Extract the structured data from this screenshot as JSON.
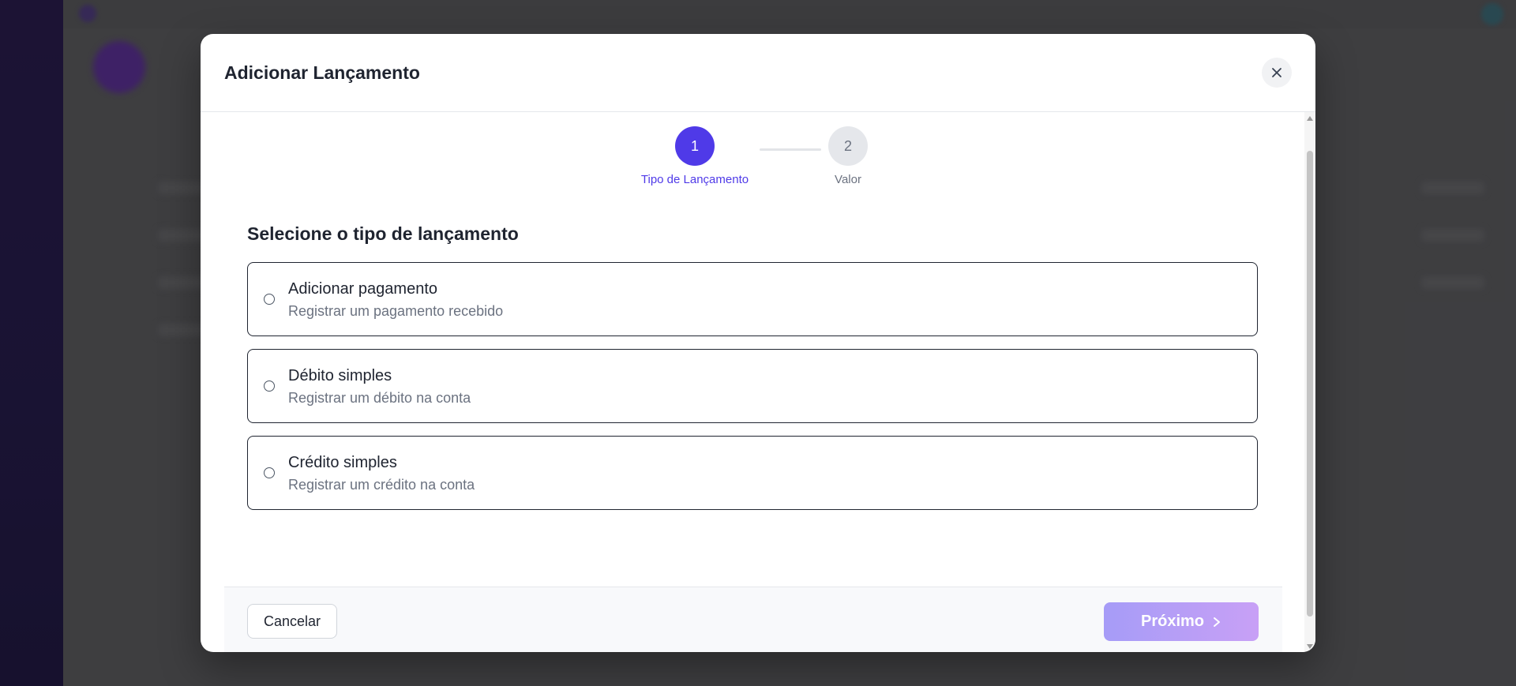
{
  "modal": {
    "title": "Adicionar Lançamento",
    "close_icon": "close-icon"
  },
  "stepper": {
    "steps": [
      {
        "number": "1",
        "label": "Tipo de Lançamento",
        "state": "active"
      },
      {
        "number": "2",
        "label": "Valor",
        "state": "inactive"
      }
    ]
  },
  "section": {
    "title": "Selecione o tipo de lançamento"
  },
  "options": [
    {
      "title": "Adicionar pagamento",
      "description": "Registrar um pagamento recebido",
      "selected": false
    },
    {
      "title": "Débito simples",
      "description": "Registrar um débito na conta",
      "selected": false
    },
    {
      "title": "Crédito simples",
      "description": "Registrar um crédito na conta",
      "selected": false
    }
  ],
  "footer": {
    "cancel_label": "Cancelar",
    "next_label": "Próximo",
    "next_icon": "chevron-right-icon"
  },
  "colors": {
    "accent": "#4f3ae8",
    "next_gradient_start": "#a69cf7",
    "next_gradient_end": "#c8a0f6"
  }
}
